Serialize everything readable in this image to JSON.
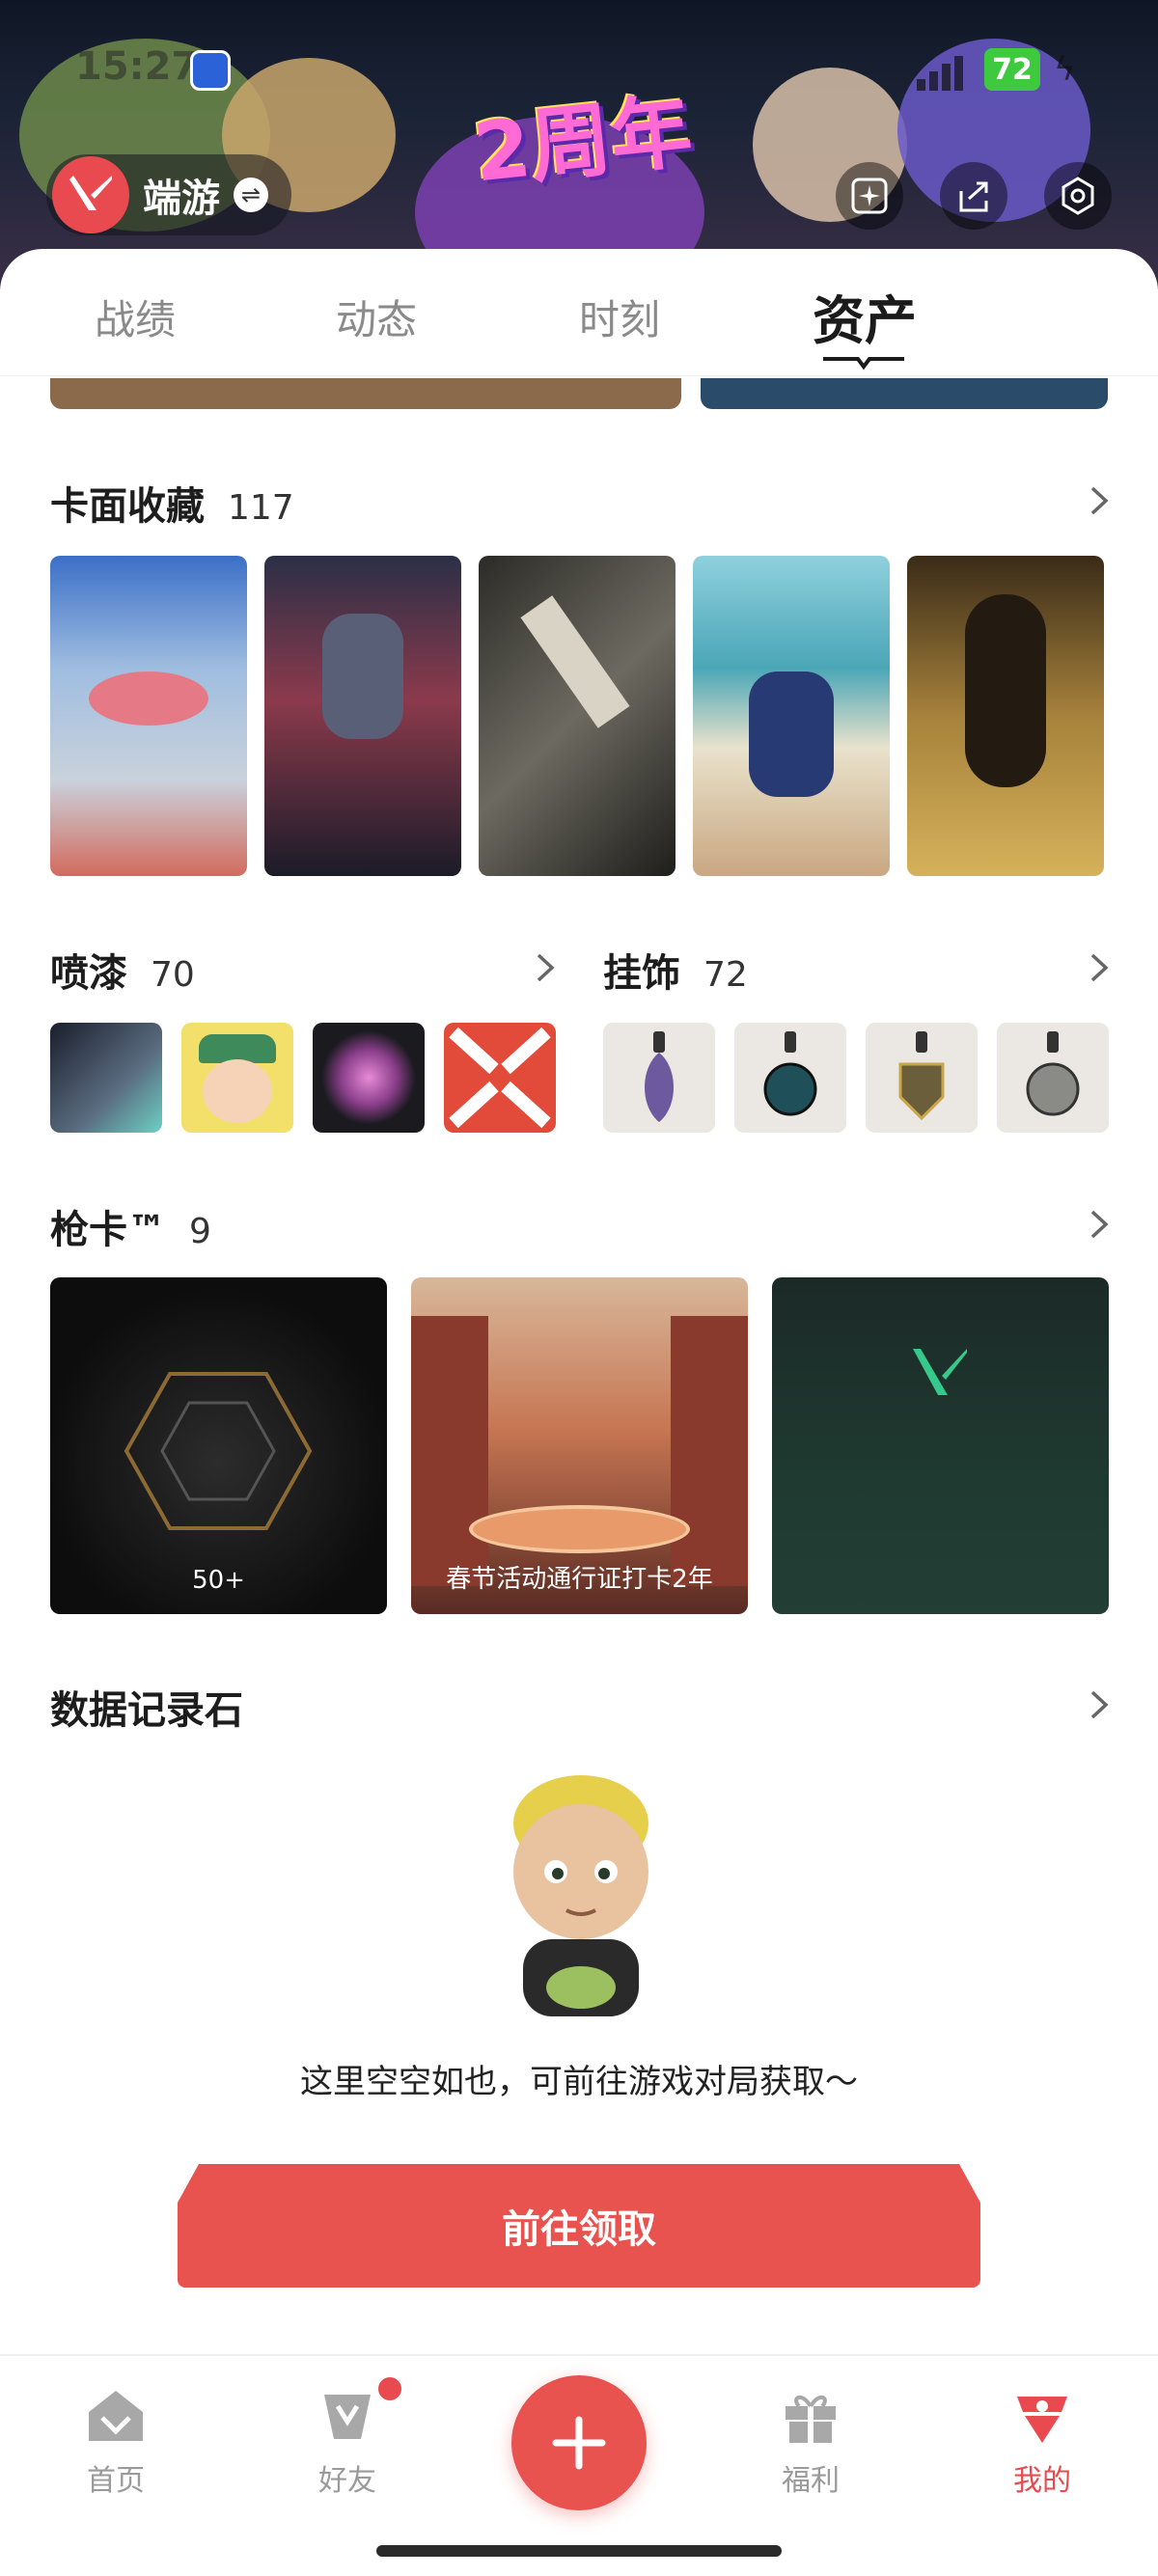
{
  "status_bar": {
    "time": "15:27",
    "battery": "72"
  },
  "banner": {
    "event_title": "2周年"
  },
  "brand": {
    "name": "端游"
  },
  "tabs": [
    {
      "label": "战绩"
    },
    {
      "label": "动态"
    },
    {
      "label": "时刻"
    },
    {
      "label": "资产"
    }
  ],
  "active_tab": "资产",
  "card_collection": {
    "title": "卡面收藏",
    "count": "117"
  },
  "sprays": {
    "title": "喷漆",
    "count": "70"
  },
  "charms": {
    "title": "挂饰",
    "count": "72"
  },
  "gun_cards": {
    "title": "枪卡™",
    "count": "9",
    "items": [
      {
        "label": "50+"
      },
      {
        "label": "春节活动通行证打卡2年"
      },
      {
        "label": ""
      }
    ]
  },
  "data_stone": {
    "title": "数据记录石",
    "empty_text": "这里空空如也，可前往游戏对局获取～",
    "button_label": "前往领取"
  },
  "bottom_nav": [
    {
      "label": "首页"
    },
    {
      "label": "好友"
    },
    {
      "label": "福利"
    },
    {
      "label": "我的"
    }
  ],
  "colors": {
    "accent": "#e8524f",
    "inactive": "#9a9a9a",
    "active_nav": "#e84a4f"
  }
}
